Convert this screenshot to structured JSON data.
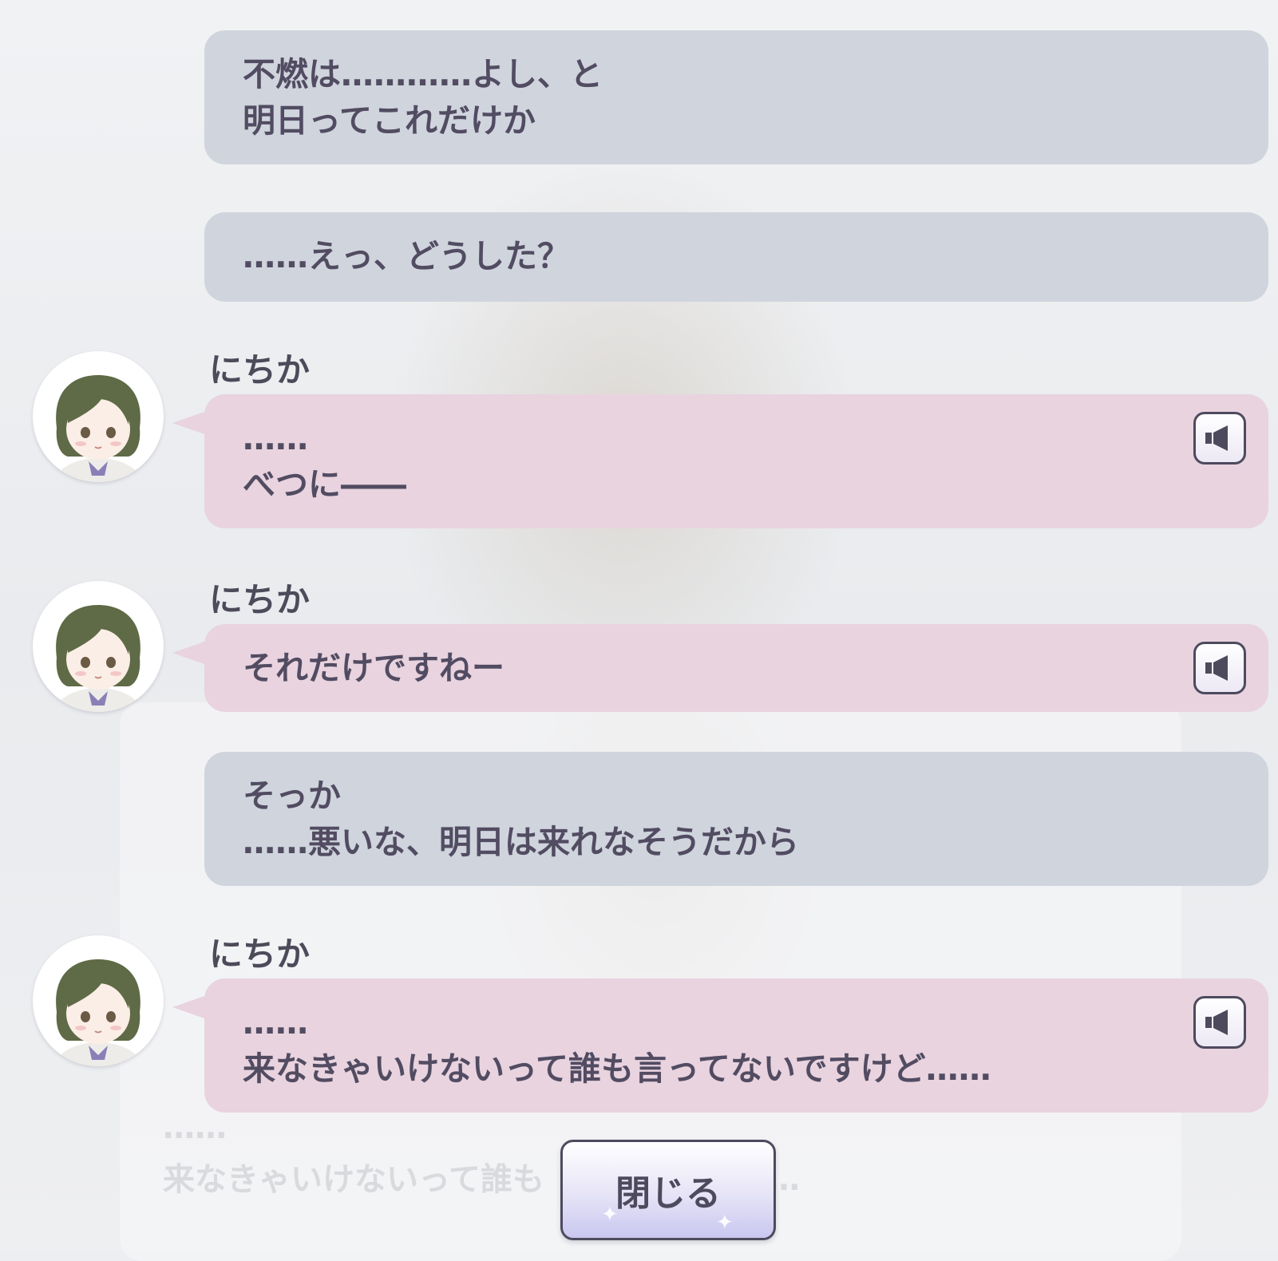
{
  "messages": [
    {
      "type": "own",
      "lines": [
        "不燃は…………よし、と",
        "明日ってこれだけか"
      ]
    },
    {
      "type": "own",
      "lines": [
        "……えっ、どうした？"
      ]
    },
    {
      "type": "chara",
      "speaker": "にちか",
      "lines": [
        "……",
        "べつに――"
      ]
    },
    {
      "type": "chara",
      "speaker": "にちか",
      "lines": [
        "それだけですねー"
      ]
    },
    {
      "type": "own",
      "lines": [
        "そっか",
        "……悪いな、明日は来れなそうだから"
      ]
    },
    {
      "type": "chara",
      "speaker": "にちか",
      "lines": [
        "……",
        "来なきゃいけないって誰も言ってないですけど……"
      ]
    }
  ],
  "close_button": {
    "label": "閉じる"
  },
  "background_ghost": {
    "line1": "……",
    "line2": "来なきゃいけないって誰も　　　　けど……"
  },
  "colors": {
    "own_bubble": "#cfd4dd",
    "chara_bubble": "#e8d3df",
    "text": "#524c62",
    "button_border": "#4e4a5e"
  },
  "icons": {
    "voice": "speaker-icon",
    "avatar": "character-avatar"
  }
}
